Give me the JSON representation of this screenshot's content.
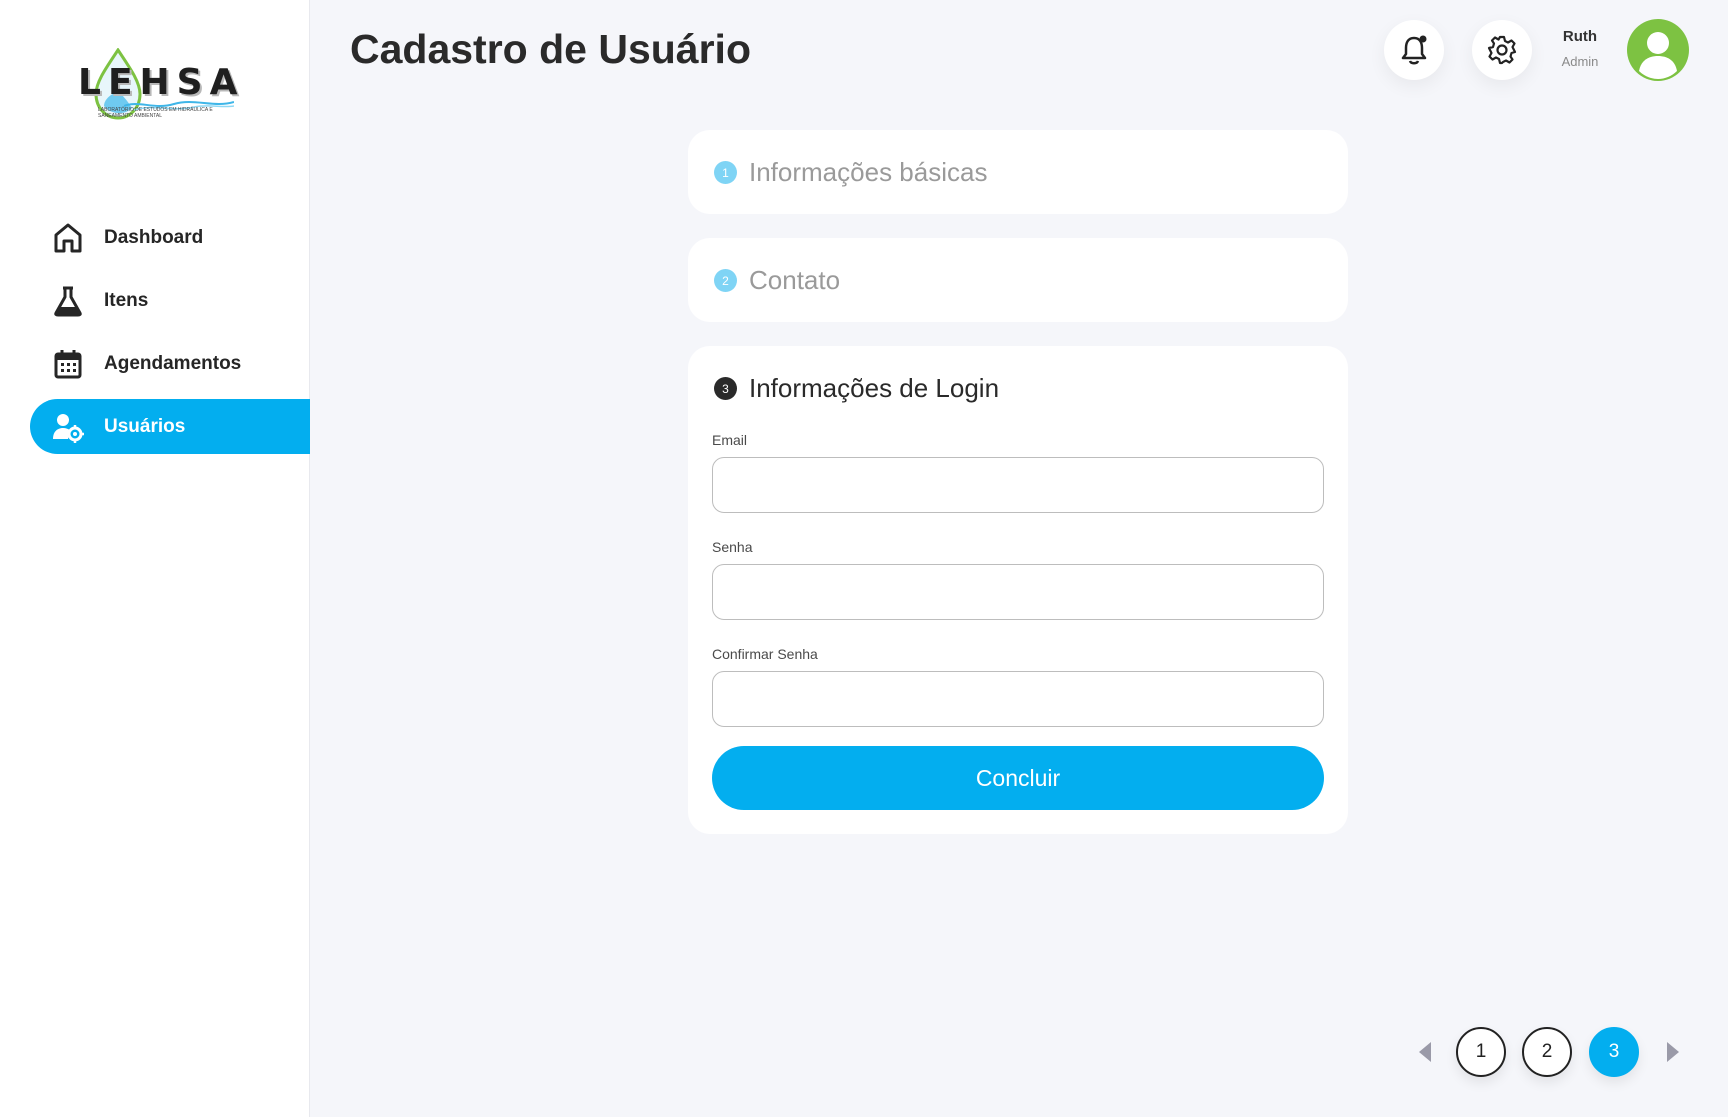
{
  "brand": {
    "logo_text": "LEHSA",
    "logo_subtitle": "Laboratório de Estudos em Hidráulica e Saneamento Ambiental"
  },
  "sidebar": {
    "items": [
      {
        "label": "Dashboard",
        "icon": "home-icon",
        "active": false
      },
      {
        "label": "Itens",
        "icon": "flask-icon",
        "active": false
      },
      {
        "label": "Agendamentos",
        "icon": "calendar-icon",
        "active": false
      },
      {
        "label": "Usuários",
        "icon": "user-gear-icon",
        "active": true
      }
    ]
  },
  "header": {
    "title": "Cadastro de Usuário",
    "user": {
      "name": "Ruth",
      "role": "Admin"
    }
  },
  "steps": [
    {
      "number": "1",
      "title": "Informações básicas",
      "state": "done"
    },
    {
      "number": "2",
      "title": "Contato",
      "state": "done"
    },
    {
      "number": "3",
      "title": "Informações de Login",
      "state": "current"
    }
  ],
  "form": {
    "email_label": "Email",
    "email_value": "",
    "password_label": "Senha",
    "password_value": "",
    "confirm_label": "Confirmar Senha",
    "confirm_value": "",
    "submit_label": "Concluir"
  },
  "pagination": {
    "pages": [
      "1",
      "2",
      "3"
    ],
    "current": "3"
  },
  "colors": {
    "accent": "#03aeef",
    "avatar": "#7dc242",
    "step_done": "#7fd4f5",
    "background": "#f5f6fa"
  }
}
